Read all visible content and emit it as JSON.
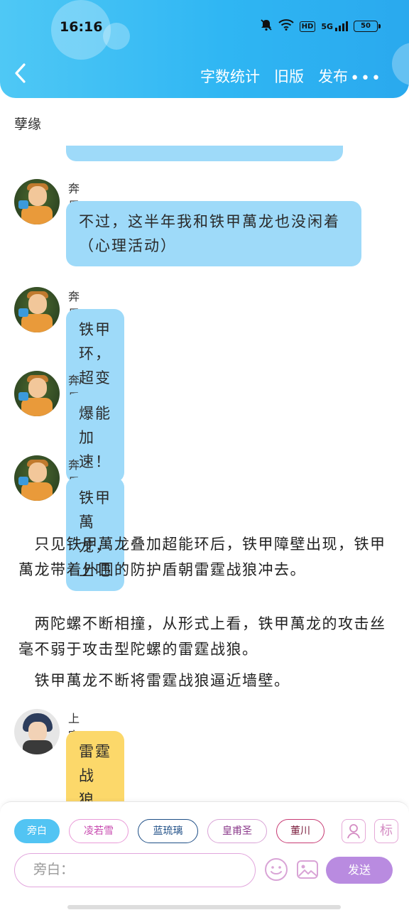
{
  "status_bar": {
    "time": "16:16",
    "network": "5G",
    "hd": "HD",
    "battery": "50"
  },
  "header": {
    "actions": [
      "字数统计",
      "旧版",
      "发布"
    ],
    "more": "•••"
  },
  "novel": {
    "title": "孽缘"
  },
  "messages": [
    {
      "sender": "奔尼",
      "text": "不过，这半年我和铁甲萬龙也没闲着（心理活动）"
    },
    {
      "sender": "奔尼",
      "text": "铁甲环，超变合体！"
    },
    {
      "sender": "奔尼",
      "text": "爆能加速！"
    },
    {
      "sender": "奔尼",
      "text": "铁甲萬龙，上吧"
    }
  ],
  "narration": [
    "　只见铁甲萬龙叠加超能环后，铁甲障壁出现，铁甲萬龙带着外围的防护盾朝雷霆战狼冲去。",
    "　两陀螺不断相撞，从形式上看，铁甲萬龙的攻击丝毫不弱于攻击型陀螺的雷霆战狼。",
    "　铁甲萬龙不断将雷霆战狼逼近墙壁。"
  ],
  "last_message": {
    "sender": "上官良",
    "text": "雷霆战狼，超速逆转！"
  },
  "roles": [
    "旁白",
    "凌若雪",
    "蓝琉璃",
    "皇甫圣",
    "董川"
  ],
  "role_icon": "person-icon",
  "tag_icon_label": "标",
  "input": {
    "placeholder": "旁白："
  },
  "send_label": "发送"
}
